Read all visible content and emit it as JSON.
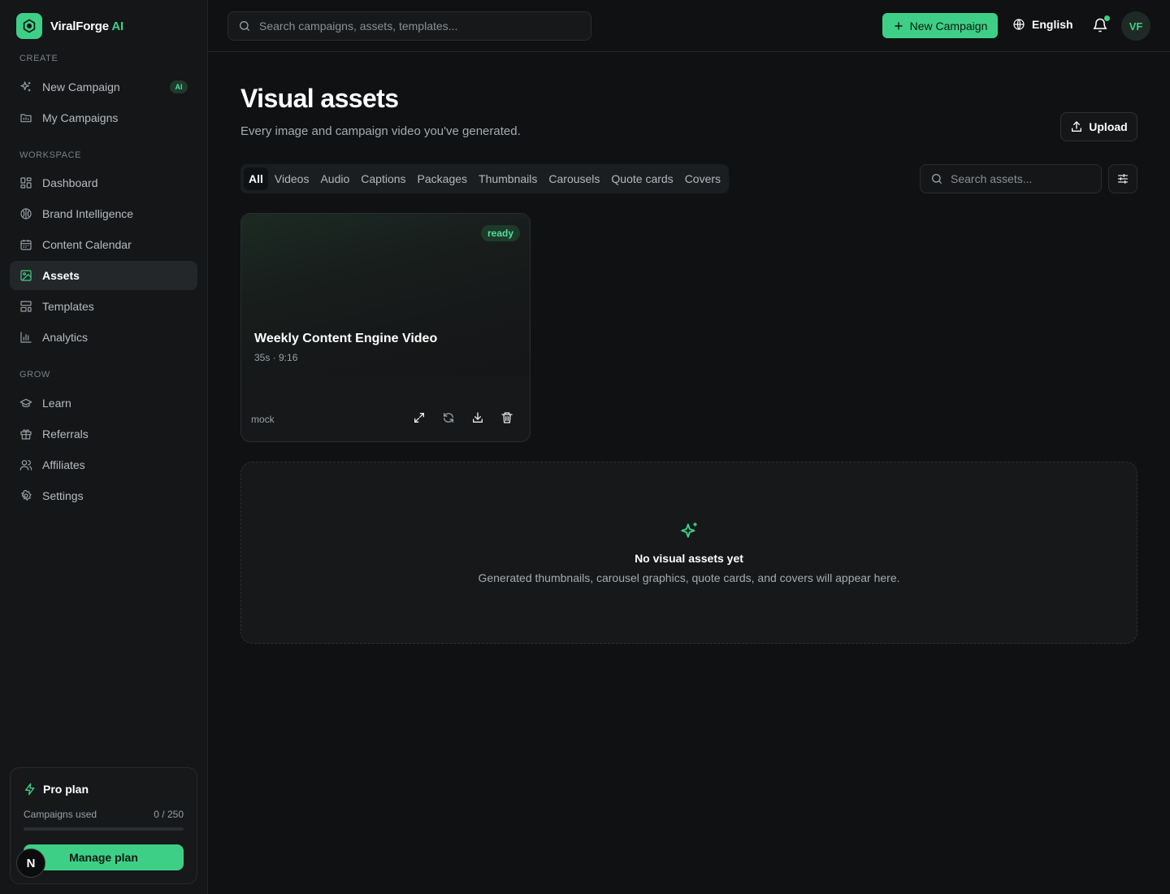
{
  "brand": {
    "name": "ViralForge",
    "name_accent": "AI"
  },
  "topbar": {
    "search_placeholder": "Search campaigns, assets, templates...",
    "new_campaign_label": "New Campaign",
    "language_label": "English",
    "avatar_initials": "VF"
  },
  "sidebar": {
    "sections": {
      "create": "CREATE",
      "workspace": "WORKSPACE",
      "grow": "GROW"
    },
    "create_items": [
      {
        "label": "New Campaign",
        "badge": "AI"
      },
      {
        "label": "My Campaigns"
      }
    ],
    "workspace_items": [
      {
        "label": "Dashboard"
      },
      {
        "label": "Brand Intelligence"
      },
      {
        "label": "Content Calendar"
      },
      {
        "label": "Assets"
      },
      {
        "label": "Templates"
      },
      {
        "label": "Analytics"
      }
    ],
    "grow_items": [
      {
        "label": "Learn"
      },
      {
        "label": "Referrals"
      },
      {
        "label": "Affiliates"
      },
      {
        "label": "Settings"
      }
    ],
    "active_item": "Assets"
  },
  "plan": {
    "title": "Pro plan",
    "usage_label": "Campaigns used",
    "usage_value": "0 / 250",
    "usage_fraction": 0,
    "manage_label": "Manage plan"
  },
  "floating_avatar": "N",
  "main": {
    "title": "Visual assets",
    "subtitle": "Every image and campaign video you've generated.",
    "upload_label": "Upload",
    "tabs": [
      "All",
      "Videos",
      "Audio",
      "Captions",
      "Packages",
      "Thumbnails",
      "Carousels",
      "Quote cards",
      "Covers"
    ],
    "active_tab": "All",
    "asset_search_placeholder": "Search assets...",
    "assets": [
      {
        "title": "Weekly Content Engine Video",
        "meta": "35s · 9:16",
        "status": "ready",
        "source": "mock"
      }
    ],
    "empty_state": {
      "title": "No visual assets yet",
      "text": "Generated thumbnails, carousel graphics, quote cards, and covers will appear here."
    }
  },
  "colors": {
    "accent": "#3ecf86",
    "background": "#0f1112",
    "sidebar": "#141618"
  }
}
